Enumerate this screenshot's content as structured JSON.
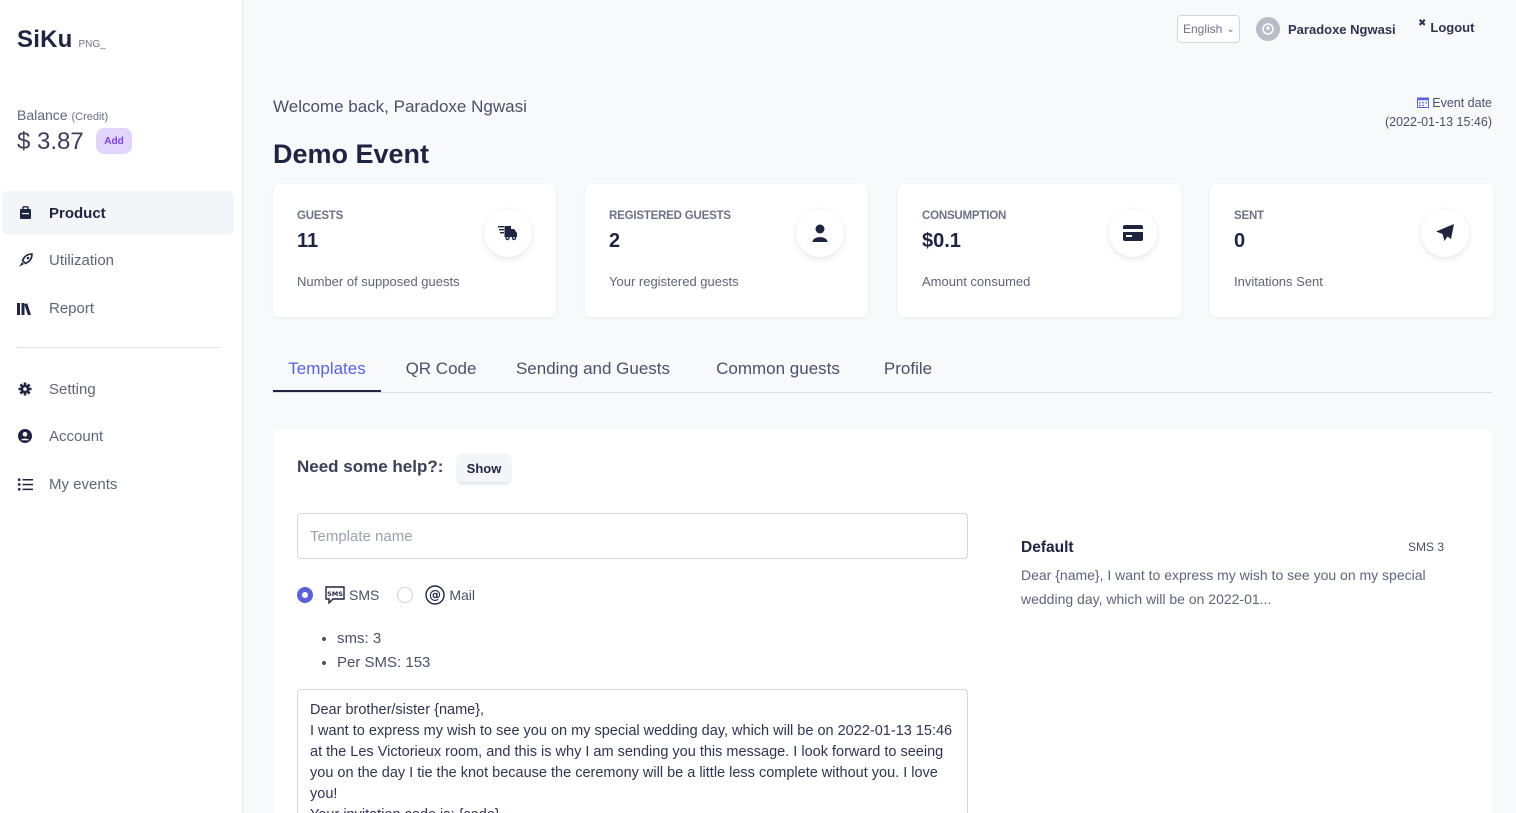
{
  "brand": {
    "name": "SiKu",
    "sub": "PNG_"
  },
  "balance": {
    "label": "Balance",
    "credit": "(Credit)",
    "value": "$ 3.87",
    "add_label": "Add"
  },
  "nav": {
    "items": [
      {
        "label": "Product",
        "icon": "briefcase-icon"
      },
      {
        "label": "Utilization",
        "icon": "rocket-icon"
      },
      {
        "label": "Report",
        "icon": "books-icon"
      },
      {
        "label": "Setting",
        "icon": "gear-icon"
      },
      {
        "label": "Account",
        "icon": "user-circle-icon"
      },
      {
        "label": "My events",
        "icon": "list-icon"
      }
    ]
  },
  "topbar": {
    "language": "English",
    "user_name": "Paradoxe Ngwasi",
    "logout": "Logout"
  },
  "header": {
    "welcome": "Welcome back, Paradoxe Ngwasi",
    "event_title": "Demo Event",
    "event_date_label": "Event date",
    "event_date_value": "(2022-01-13 15:46)"
  },
  "stats": [
    {
      "label": "GUESTS",
      "value": "11",
      "desc": "Number of supposed guests",
      "icon": "truck-icon"
    },
    {
      "label": "REGISTERED GUESTS",
      "value": "2",
      "desc": "Your registered guests",
      "icon": "user-icon"
    },
    {
      "label": "CONSUMPTION",
      "value": "$0.1",
      "desc": "Amount consumed",
      "icon": "credit-card-icon"
    },
    {
      "label": "SENT",
      "value": "0",
      "desc": "Invitations Sent",
      "icon": "paper-plane-icon"
    }
  ],
  "tabs": [
    "Templates",
    "QR Code",
    "Sending and Guests",
    "Common guests",
    "Profile"
  ],
  "panel": {
    "help_label": "Need some help?:",
    "show_label": "Show",
    "template_name_placeholder": "Template name",
    "template_name_value": "",
    "radio_sms": "SMS",
    "radio_mail": "Mail",
    "info": [
      "sms: 3",
      "Per SMS: 153"
    ],
    "message": "Dear brother/sister {name},\nI want to express my wish to see you on my special wedding day, which will be on 2022-01-13 15:46 at the Les Victorieux room, and this is why I am sending you this message. I look forward to seeing you on the day I tie the knot because the ceremony will be a little less complete without you. I love you!\nYour invitation code is: {code}"
  },
  "preview": {
    "title": "Default",
    "count": "SMS 3",
    "body": "Dear {name}, I want to express my wish to see you on my special wedding day, which will be on 2022-01..."
  },
  "colors": {
    "accent": "#5b62d8",
    "badge_bg": "#e2d5fb",
    "badge_text": "#7b3fe4",
    "dark": "#1f2541"
  }
}
